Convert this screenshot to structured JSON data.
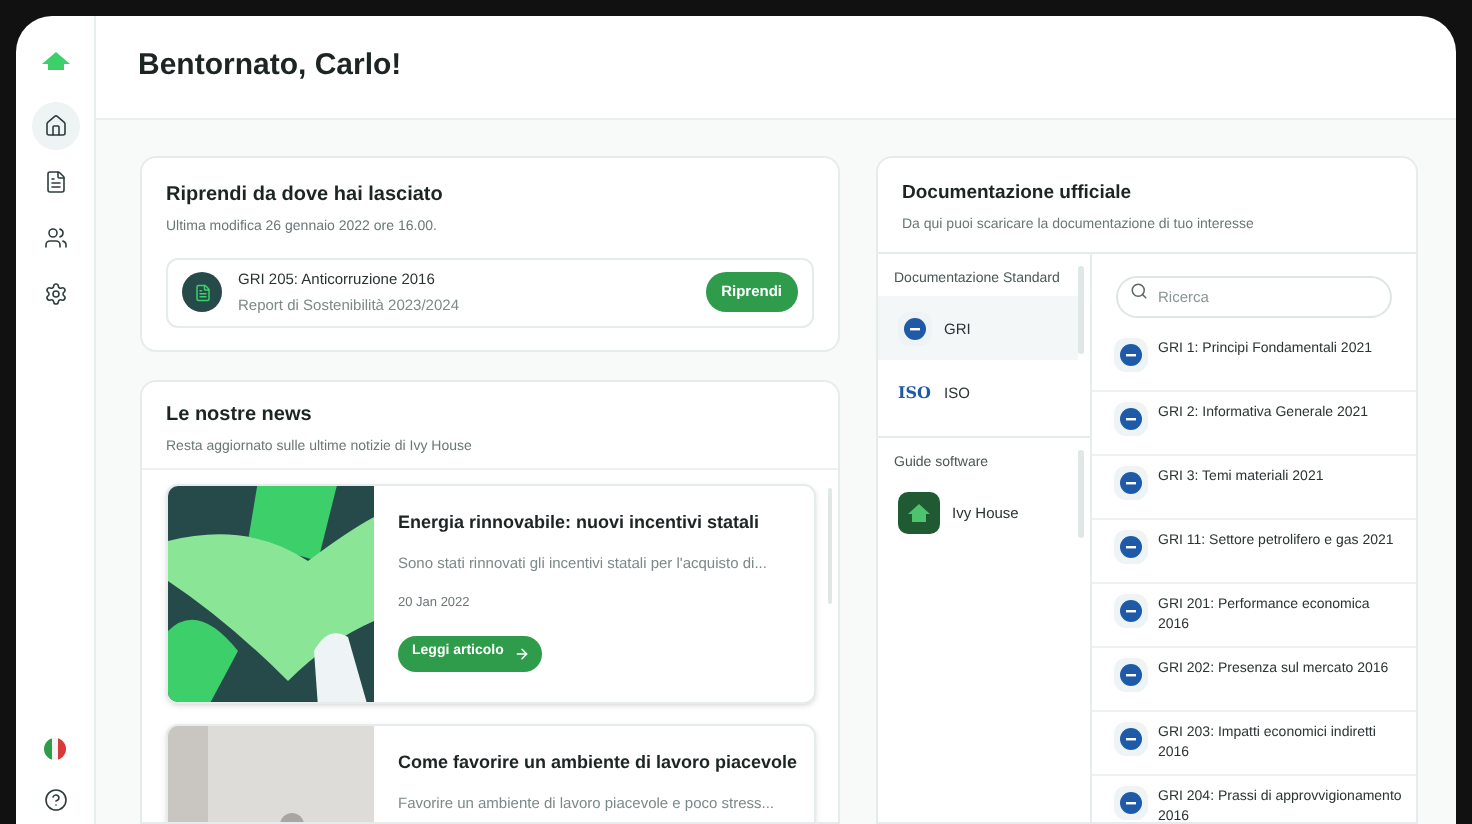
{
  "greeting": "Bentornato, Carlo!",
  "nav": [
    {
      "kind": "home",
      "selected": true
    },
    {
      "kind": "document",
      "selected": false
    },
    {
      "kind": "people",
      "selected": false
    },
    {
      "kind": "settings",
      "selected": false
    }
  ],
  "resume": {
    "title": "Riprendi da dove hai lasciato",
    "subtitle": "Ultima modifica 26 gennaio 2022 ore 16.00.",
    "item_title": "GRI 205: Anticorruzione 2016",
    "item_subtitle": "Report di Sostenibilità 2023/2024",
    "button": "Riprendi"
  },
  "news": {
    "title": "Le nostre news",
    "subtitle": "Resta aggiornato sulle ultime notizie di Ivy House",
    "articles": [
      {
        "title": "Energia rinnovabile: nuovi incentivi statali",
        "excerpt": "Sono stati rinnovati gli incentivi statali per l'acquisto di...",
        "date": "20 Jan 2022",
        "button": "Leggi articolo"
      },
      {
        "title": "Come favorire un ambiente di lavoro piacevole",
        "excerpt": "Favorire un ambiente di lavoro piacevole e poco stress..."
      }
    ]
  },
  "docs": {
    "title": "Documentazione ufficiale",
    "subtitle": "Da qui puoi scaricare la documentazione di tuo interesse",
    "groups": [
      {
        "label": "Documentazione Standard",
        "items": [
          {
            "name": "GRI",
            "kind": "gri",
            "selected": true
          },
          {
            "name": "ISO",
            "kind": "iso",
            "logo_text": "ISO",
            "selected": false
          }
        ]
      },
      {
        "label": "Guide software",
        "items": [
          {
            "name": "Ivy House",
            "kind": "ivy",
            "selected": false
          }
        ]
      }
    ],
    "search": {
      "placeholder": "Ricerca"
    },
    "documents": [
      "GRI 1: Principi Fondamentali 2021",
      "GRI 2: Informativa Generale 2021",
      "GRI 3: Temi materiali 2021",
      "GRI 11: Settore petrolifero e gas 2021",
      "GRI 201: Performance economica 2016",
      "GRI 202: Presenza sul mercato 2016",
      "GRI 203: Impatti economici indiretti 2016",
      "GRI 204: Prassi di approvvigionamento 2016"
    ]
  }
}
